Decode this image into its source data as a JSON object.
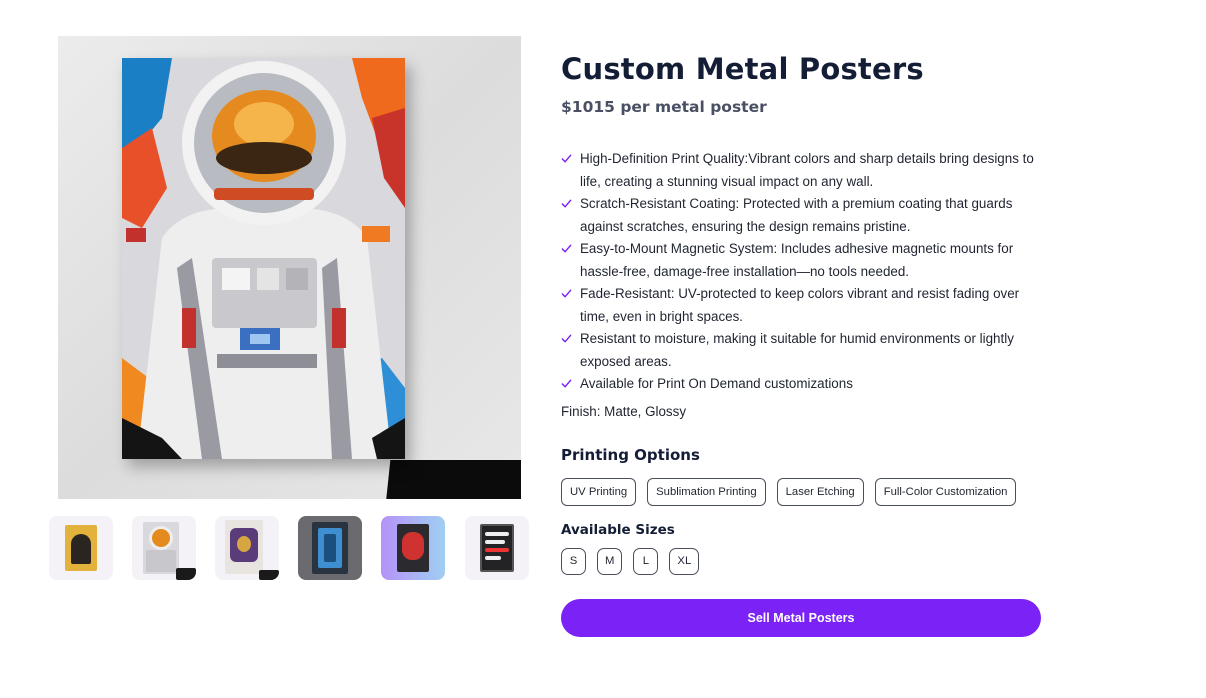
{
  "product": {
    "title": "Custom Metal Posters",
    "price": "$1015 per metal poster"
  },
  "gallery": {
    "main_image": "astronaut-metal-poster",
    "thumbnails": [
      {
        "subject": "batman"
      },
      {
        "subject": "astronaut"
      },
      {
        "subject": "ornate-emblem"
      },
      {
        "subject": "blue-robot"
      },
      {
        "subject": "red-character"
      },
      {
        "subject": "text-poster"
      }
    ]
  },
  "features": [
    "High-Definition Print Quality:Vibrant colors and sharp details bring designs to life, creating a stunning visual impact on any wall.",
    "Scratch-Resistant Coating: Protected with a premium coating that guards against scratches, ensuring the design remains pristine.",
    "Easy-to-Mount Magnetic System: Includes adhesive magnetic mounts for hassle-free, damage-free installation—no tools needed.",
    "Fade-Resistant: UV-protected to keep colors vibrant and resist fading over time, even in bright spaces.",
    "Resistant to moisture, making it suitable for humid environments or lightly exposed areas.",
    "Available for Print On Demand customizations"
  ],
  "finish": "Finish: Matte, Glossy",
  "printing": {
    "label": "Printing Options",
    "options": [
      "UV Printing",
      "Sublimation Printing",
      "Laser Etching",
      "Full-Color Customization"
    ]
  },
  "sizes": {
    "label": "Available Sizes",
    "options": [
      "S",
      "M",
      "L",
      "XL"
    ]
  },
  "cta": {
    "label": "Sell Metal Posters"
  },
  "colors": {
    "accent": "#7b22f7",
    "heading": "#141d36",
    "check": "#7b22f7"
  },
  "icons": {
    "feature_bullet": "check-icon"
  }
}
